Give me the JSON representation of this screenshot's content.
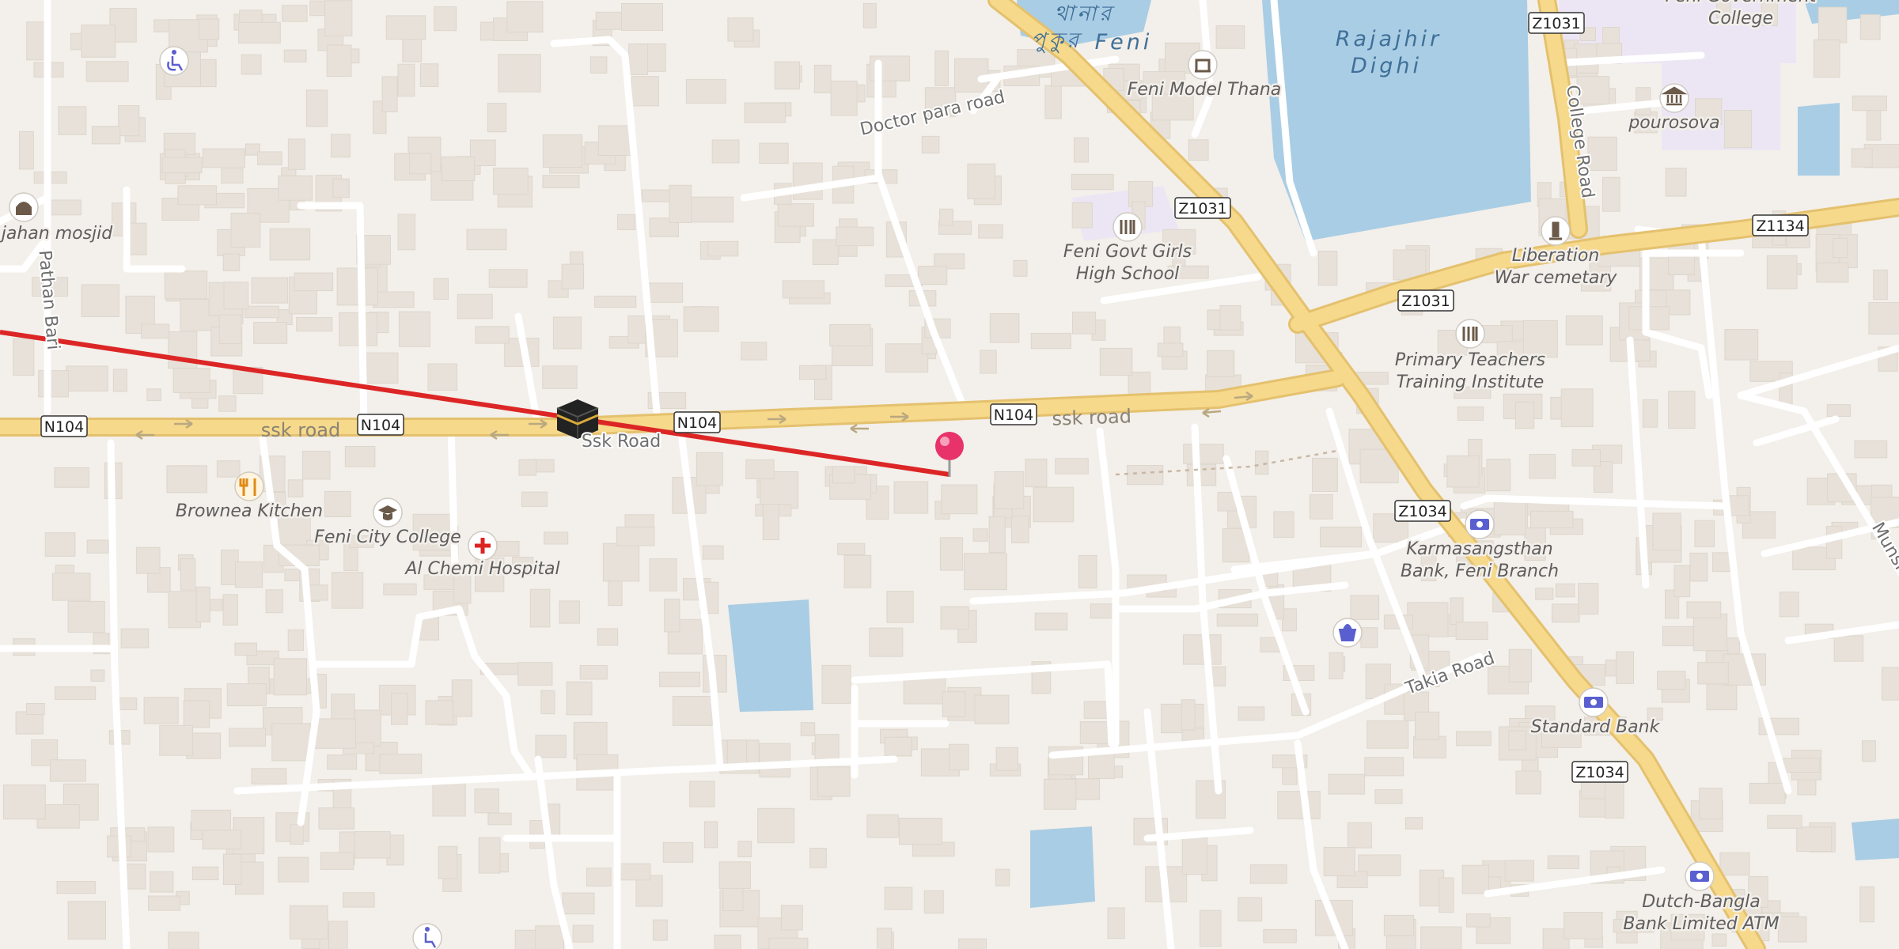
{
  "map": {
    "roads": [
      {
        "name": "ssk road"
      },
      {
        "name": "ssk road"
      },
      {
        "name": "Ssk Road"
      },
      {
        "name": "Doctor para road"
      },
      {
        "name": "College Road"
      },
      {
        "name": "Takia Road"
      },
      {
        "name": "Pathan Bari"
      },
      {
        "name": "Munshi"
      }
    ],
    "shields": [
      "N104",
      "N104",
      "N104",
      "N104",
      "Z1031",
      "Z1031",
      "Z1031",
      "Z1134",
      "Z1034",
      "Z1034"
    ],
    "water_labels": [
      "Rajajhir",
      "Dighi",
      "থানার",
      "পুকুর",
      "Feni"
    ],
    "pois": [
      {
        "name": "jahan mosjid",
        "icon": "mosque-icon"
      },
      {
        "name": "Feni Model Thana",
        "icon": "police-icon"
      },
      {
        "name": "pourosova",
        "icon": "townhall-icon"
      },
      {
        "name": "Feni Govt Girls",
        "name2": "High School",
        "icon": "school-icon"
      },
      {
        "name": "Liberation",
        "name2": "War cemetary",
        "icon": "monument-icon"
      },
      {
        "name": "Primary Teachers",
        "name2": "Training Institute",
        "icon": "school-icon"
      },
      {
        "name": "Brownea Kitchen",
        "icon": "restaurant-icon"
      },
      {
        "name": "Feni City College",
        "icon": "college-icon"
      },
      {
        "name": "Al Chemi Hospital",
        "icon": "hospital-icon"
      },
      {
        "name": "Karmasangsthan",
        "name2": "Bank, Feni Branch",
        "icon": "bank-icon"
      },
      {
        "name": "Standard Bank",
        "icon": "bank-icon"
      },
      {
        "name": "Dutch-Bangla",
        "name2": "Bank Limited ATM",
        "icon": "atm-icon"
      },
      {
        "name": "Feni Government",
        "name2": "College",
        "icon": "college-icon"
      }
    ],
    "marker": {
      "icon": "map-pin-icon"
    },
    "qibla": {
      "icon": "kaaba-icon"
    },
    "colors": {
      "background": "#f3efea",
      "building": "#e7e1d9",
      "major_road": "#f6d98a",
      "minor_road": "#ffffff",
      "water": "#a9cde4",
      "qibla_line": "#dc2626",
      "pin": "#e8336a"
    }
  }
}
